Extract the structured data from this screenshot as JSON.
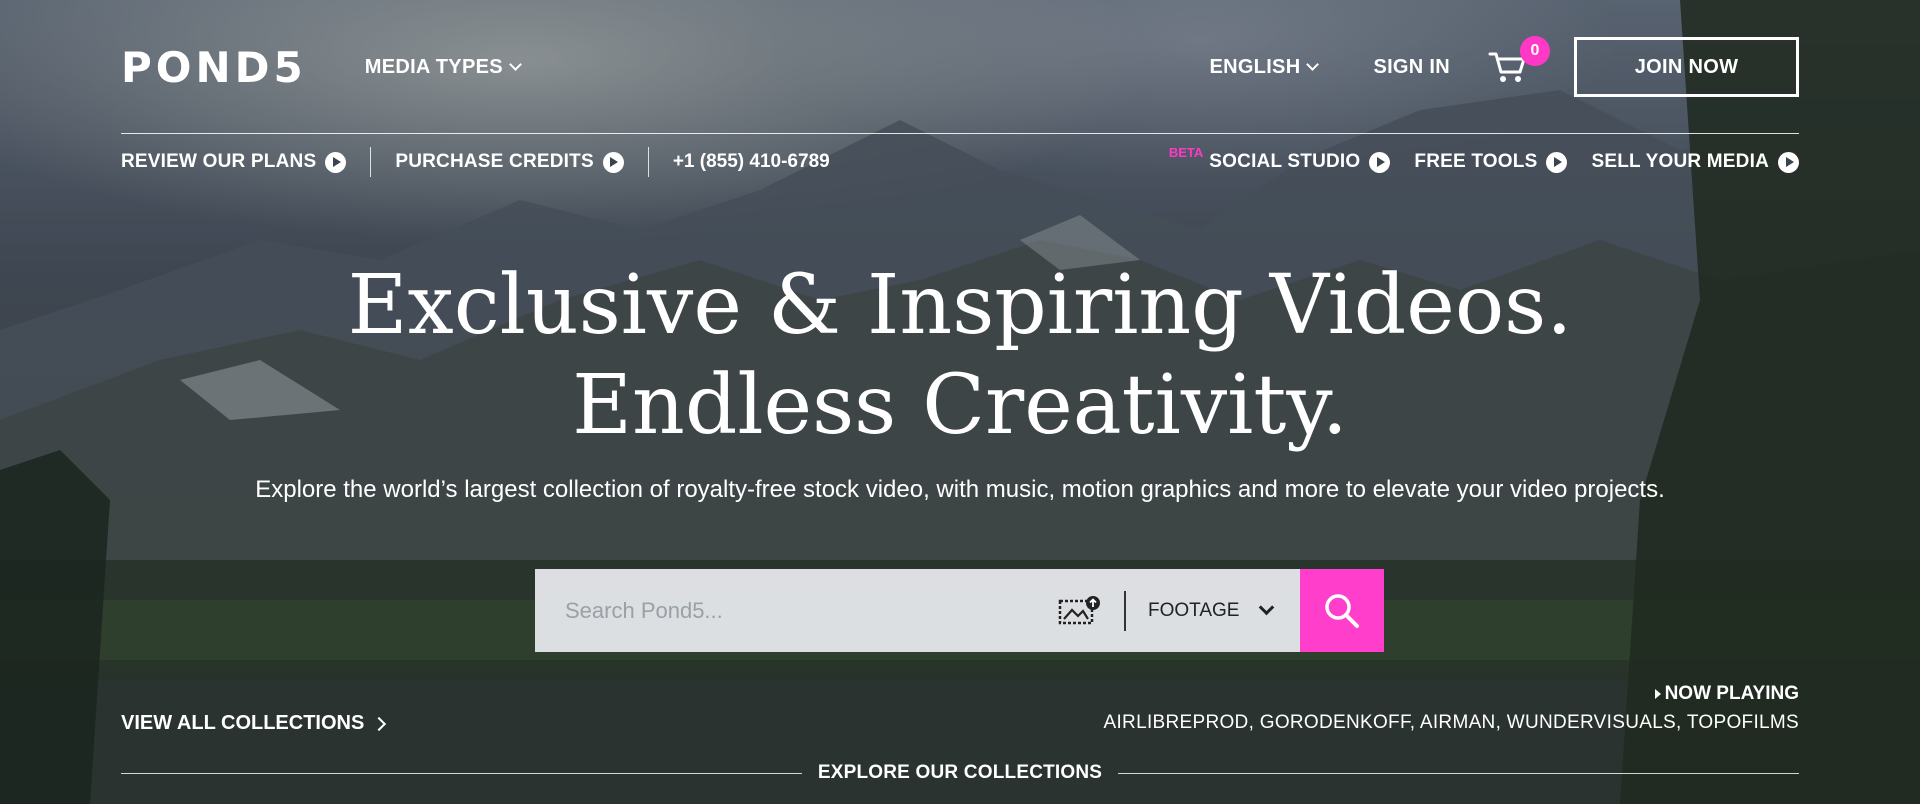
{
  "header": {
    "logo": "POND5",
    "media_types_label": "MEDIA TYPES",
    "language_label": "ENGLISH",
    "sign_in_label": "SIGN IN",
    "cart_count": "0",
    "join_label": "JOIN NOW"
  },
  "subnav": {
    "review_plans": "REVIEW OUR PLANS",
    "purchase_credits": "PURCHASE CREDITS",
    "phone": "+1 (855) 410-6789",
    "beta_badge": "BETA",
    "social_studio": "SOCIAL STUDIO",
    "free_tools": "FREE TOOLS",
    "sell_media": "SELL YOUR MEDIA"
  },
  "hero": {
    "headline_line1": "Exclusive & Inspiring Videos.",
    "headline_line2": "Endless Creativity.",
    "subtitle": "Explore the world’s largest collection of royalty-free stock video, with music, motion graphics and more to elevate your video projects."
  },
  "search": {
    "placeholder": "Search Pond5...",
    "value": "",
    "media_type_selected": "FOOTAGE"
  },
  "footer_strip": {
    "view_all_collections": "VIEW ALL COLLECTIONS",
    "now_playing_label": "NOW PLAYING",
    "now_playing_contributors": "AIRLIBREPROD, GORODENKOFF, AIRMAN, WUNDERVISUALS, TOPOFILMS",
    "explore_collections": "EXPLORE OUR COLLECTIONS"
  },
  "colors": {
    "accent_pink": "#ff3ecb",
    "text": "#ffffff"
  },
  "icons": [
    "cart-icon",
    "play-circle-icon",
    "image-search-icon",
    "search-icon",
    "chevron-down-icon",
    "chevron-right-icon"
  ]
}
